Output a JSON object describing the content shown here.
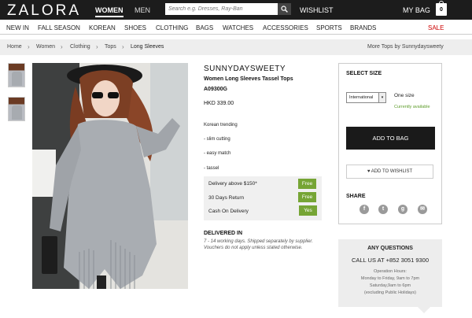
{
  "header": {
    "logo": "ZALORA",
    "gender_tabs": [
      "WOMEN",
      "MEN"
    ],
    "search_placeholder": "Search e.g. Dresses, Ray-Ban",
    "wishlist": "WISHLIST",
    "my_bag": "MY BAG",
    "bag_count": "0"
  },
  "nav": {
    "items": [
      "NEW IN",
      "FALL SEASON",
      "KOREAN",
      "SHOES",
      "CLOTHING",
      "BAGS",
      "WATCHES",
      "ACCESSORIES",
      "SPORTS",
      "BRANDS",
      "SALE"
    ]
  },
  "breadcrumb": {
    "items": [
      "Home",
      "Women",
      "Clothing",
      "Tops",
      "Long Sleeves"
    ],
    "more_link": "More Tops by Sunnydaysweety"
  },
  "product": {
    "brand": "SUNNYDAYSWEETY",
    "title": "Women Long Sleeves Tassel Tops",
    "sku": "A09300G",
    "price": "HKD 339.00",
    "description": [
      "Korean trending",
      "- slim cutting",
      "- easy match",
      "- tassel"
    ]
  },
  "delivery": {
    "rows": [
      {
        "label": "Delivery above $150*",
        "value": "Free"
      },
      {
        "label": "30 Days Return",
        "value": "Free"
      },
      {
        "label": "Cash On Delivery",
        "value": "Yes"
      }
    ],
    "delivered_in_title": "DELIVERED IN",
    "delivered_in_text": "7 - 14 working days. Shipped separately by supplier. Vouchers do not apply unless stated otherwise."
  },
  "size_panel": {
    "title": "SELECT SIZE",
    "selected": "International",
    "size": "One size",
    "availability": "Currently available",
    "add_to_bag": "ADD TO BAG",
    "add_to_wishlist": "ADD TO WISHLIST",
    "share": "SHARE",
    "social_icons": [
      "facebook-icon",
      "twitter-icon",
      "google-plus-icon",
      "email-icon"
    ]
  },
  "questions": {
    "title": "ANY QUESTIONS",
    "call": "CALL US AT +852 3051 9300",
    "hours": [
      "Operation Hours:",
      "Monday to Friday, 9am to 7pm",
      "Saturday,9am to 6pm",
      "(excluding Public Holidays)"
    ]
  },
  "colors": {
    "topbar": "#1c1c1c",
    "badge_green": "#76a535",
    "available_green": "#5d9c2a",
    "sale_red": "#cc0000"
  }
}
